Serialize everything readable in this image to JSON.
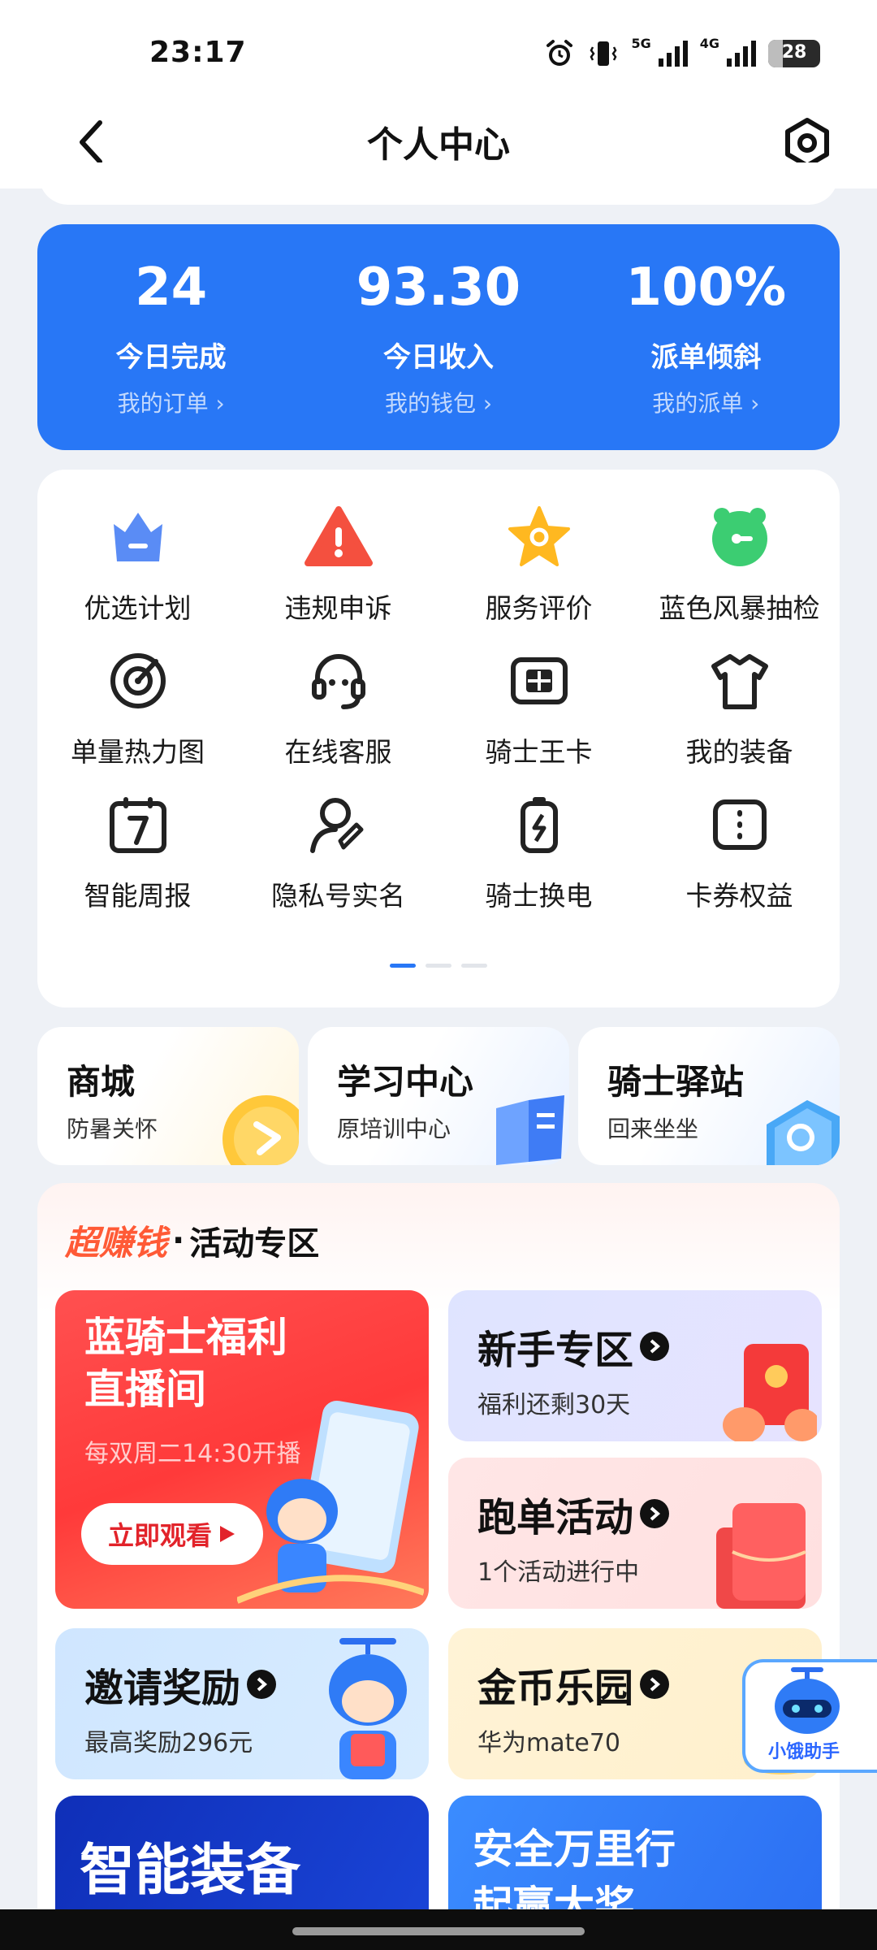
{
  "status_bar": {
    "time": "23:17",
    "net1": "5G",
    "net2": "4G",
    "battery": "28",
    "battery_fraction": 0.28
  },
  "nav": {
    "title": "个人中心"
  },
  "stats": [
    {
      "value": "24",
      "label": "今日完成",
      "link": "我的订单 ›"
    },
    {
      "value": "93.30",
      "label": "今日收入",
      "link": "我的钱包 ›"
    },
    {
      "value": "100%",
      "label": "派单倾斜",
      "link": "我的派单 ›"
    }
  ],
  "tools": [
    {
      "label": "优选计划",
      "icon": "crown-icon"
    },
    {
      "label": "违规申诉",
      "icon": "warning-icon"
    },
    {
      "label": "服务评价",
      "icon": "star-icon"
    },
    {
      "label": "蓝色风暴抽检",
      "icon": "alarm-clock-icon"
    },
    {
      "label": "单量热力图",
      "icon": "target-icon"
    },
    {
      "label": "在线客服",
      "icon": "headset-icon"
    },
    {
      "label": "骑士王卡",
      "icon": "sim-card-icon"
    },
    {
      "label": "我的装备",
      "icon": "tshirt-icon"
    },
    {
      "label": "智能周报",
      "icon": "calendar-icon"
    },
    {
      "label": "隐私号实名",
      "icon": "user-id-icon"
    },
    {
      "label": "骑士换电",
      "icon": "battery-swap-icon"
    },
    {
      "label": "卡券权益",
      "icon": "coupon-icon"
    }
  ],
  "quick": [
    {
      "title": "商城",
      "sub": "防暑关怀"
    },
    {
      "title": "学习中心",
      "sub": "原培训中心"
    },
    {
      "title": "骑士驿站",
      "sub": "回来坐坐"
    }
  ],
  "activity": {
    "brand": "超赚钱",
    "dot": "·",
    "title": "活动专区",
    "live": {
      "title1": "蓝骑士福利",
      "title2": "直播间",
      "sub": "每双周二14:30开播",
      "button": "立即观看"
    },
    "newbie": {
      "title": "新手专区",
      "sub": "福利还剩30天"
    },
    "run": {
      "title": "跑单活动",
      "sub": "1个活动进行中"
    },
    "invite": {
      "title": "邀请奖励",
      "sub": "最高奖励296元"
    },
    "coins": {
      "title": "金币乐园",
      "sub": "华为mate70"
    },
    "equip": {
      "title": "智能装备"
    },
    "safety": {
      "title1": "安全万里行",
      "title2": "起赢大奖"
    }
  },
  "assistant": {
    "label": "小饿助手"
  },
  "colors": {
    "primary": "#2877f6",
    "accent": "#ff5a36"
  }
}
